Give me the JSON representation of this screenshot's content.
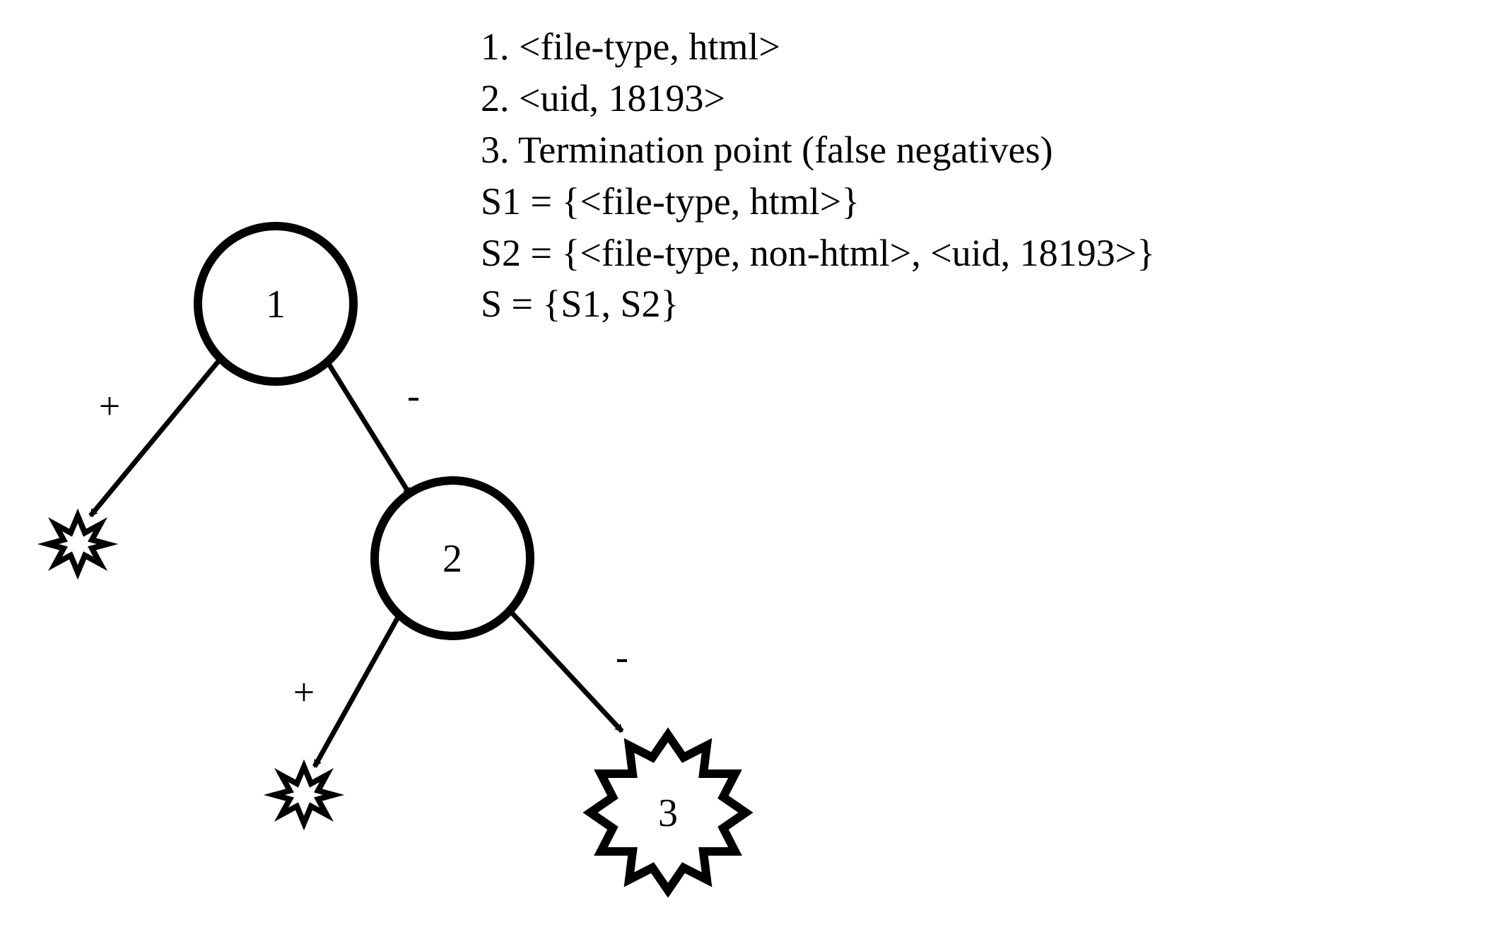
{
  "legend": {
    "line1": "1. <file-type, html>",
    "line2": "2. <uid, 18193>",
    "line3": "3. Termination point (false negatives)",
    "line4": "S1 = {<file-type, html>}",
    "line5": "S2 = {<file-type, non-html>, <uid, 18193>}",
    "line6": "S = {S1, S2}"
  },
  "nodes": {
    "n1": "1",
    "n2": "2",
    "n3": "3"
  },
  "edges": {
    "n1_left": "+",
    "n1_right": "-",
    "n2_left": "+",
    "n2_right": "-"
  }
}
